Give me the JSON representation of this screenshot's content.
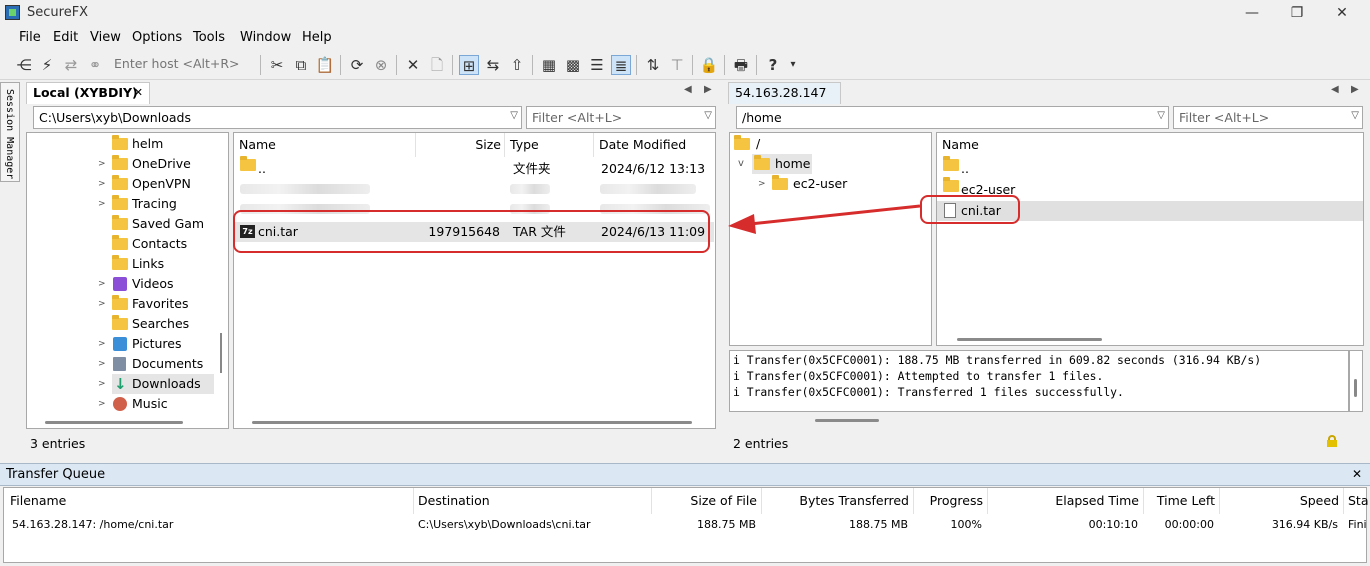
{
  "window": {
    "title": "SecureFX",
    "min": "—",
    "max": "❐",
    "close": "✕"
  },
  "menu": [
    "File",
    "Edit",
    "View",
    "Options",
    "Tools",
    "Window",
    "Help"
  ],
  "toolbar": {
    "host_placeholder": "Enter host <Alt+R>"
  },
  "session_manager": {
    "label": "Session Manager"
  },
  "local": {
    "tab": "Local (XYBDIY)",
    "tab_close": "✕",
    "path": "C:\\Users\\xyb\\Downloads",
    "filter_placeholder": "Filter <Alt+L>",
    "tree": [
      {
        "label": "helm",
        "expandable": false
      },
      {
        "label": "OneDrive",
        "expandable": true
      },
      {
        "label": "OpenVPN",
        "expandable": true
      },
      {
        "label": "Tracing",
        "expandable": true
      },
      {
        "label": "Saved Gam",
        "expandable": false
      },
      {
        "label": "Contacts",
        "expandable": false
      },
      {
        "label": "Links",
        "expandable": false
      },
      {
        "label": "Videos",
        "expandable": true
      },
      {
        "label": "Favorites",
        "expandable": true
      },
      {
        "label": "Searches",
        "expandable": false
      },
      {
        "label": "Pictures",
        "expandable": true
      },
      {
        "label": "Documents",
        "expandable": true
      },
      {
        "label": "Downloads",
        "expandable": true
      },
      {
        "label": "Music",
        "expandable": true
      }
    ],
    "columns": {
      "name": "Name",
      "size": "Size",
      "type": "Type",
      "date": "Date Modified"
    },
    "files": [
      {
        "name": "..",
        "size": "",
        "type": "文件夹",
        "date": "2024/6/12 13:13"
      },
      {
        "name": "cni.tar",
        "size": "197915648",
        "type": "TAR 文件",
        "date": "2024/6/13 11:09"
      }
    ],
    "file_badge": "7z",
    "status": "3 entries"
  },
  "remote": {
    "tab": "54.163.28.147",
    "path": "/home",
    "filter_placeholder": "Filter <Alt+L>",
    "tree": [
      {
        "label": "/"
      },
      {
        "label": "home"
      },
      {
        "label": "ec2-user"
      }
    ],
    "columns": {
      "name": "Name"
    },
    "files": [
      {
        "name": ".."
      },
      {
        "name": "ec2-user"
      },
      {
        "name": "cni.tar"
      }
    ],
    "log": [
      "i Transfer(0x5CFC0001): 188.75 MB transferred in 609.82 seconds (316.94 KB/s)",
      "i Transfer(0x5CFC0001): Attempted to transfer 1 files.",
      "i Transfer(0x5CFC0001): Transferred 1 files successfully."
    ],
    "status": "2 entries"
  },
  "transfer_queue": {
    "title": "Transfer Queue",
    "close": "✕",
    "columns": [
      "Filename",
      "Destination",
      "Size of File",
      "Bytes Transferred",
      "Progress",
      "Elapsed Time",
      "Time Left",
      "Speed",
      "Sta"
    ],
    "rows": [
      [
        "54.163.28.147: /home/cni.tar",
        "C:\\Users\\xyb\\Downloads\\cni.tar",
        "188.75 MB",
        "188.75 MB",
        "100%",
        "00:10:10",
        "00:00:00",
        "316.94 KB/s",
        "Fini"
      ]
    ]
  },
  "colors": {
    "accent_red": "#d62c2c",
    "selection": "#cde3f7",
    "queue_header": "#dbe7f3"
  }
}
